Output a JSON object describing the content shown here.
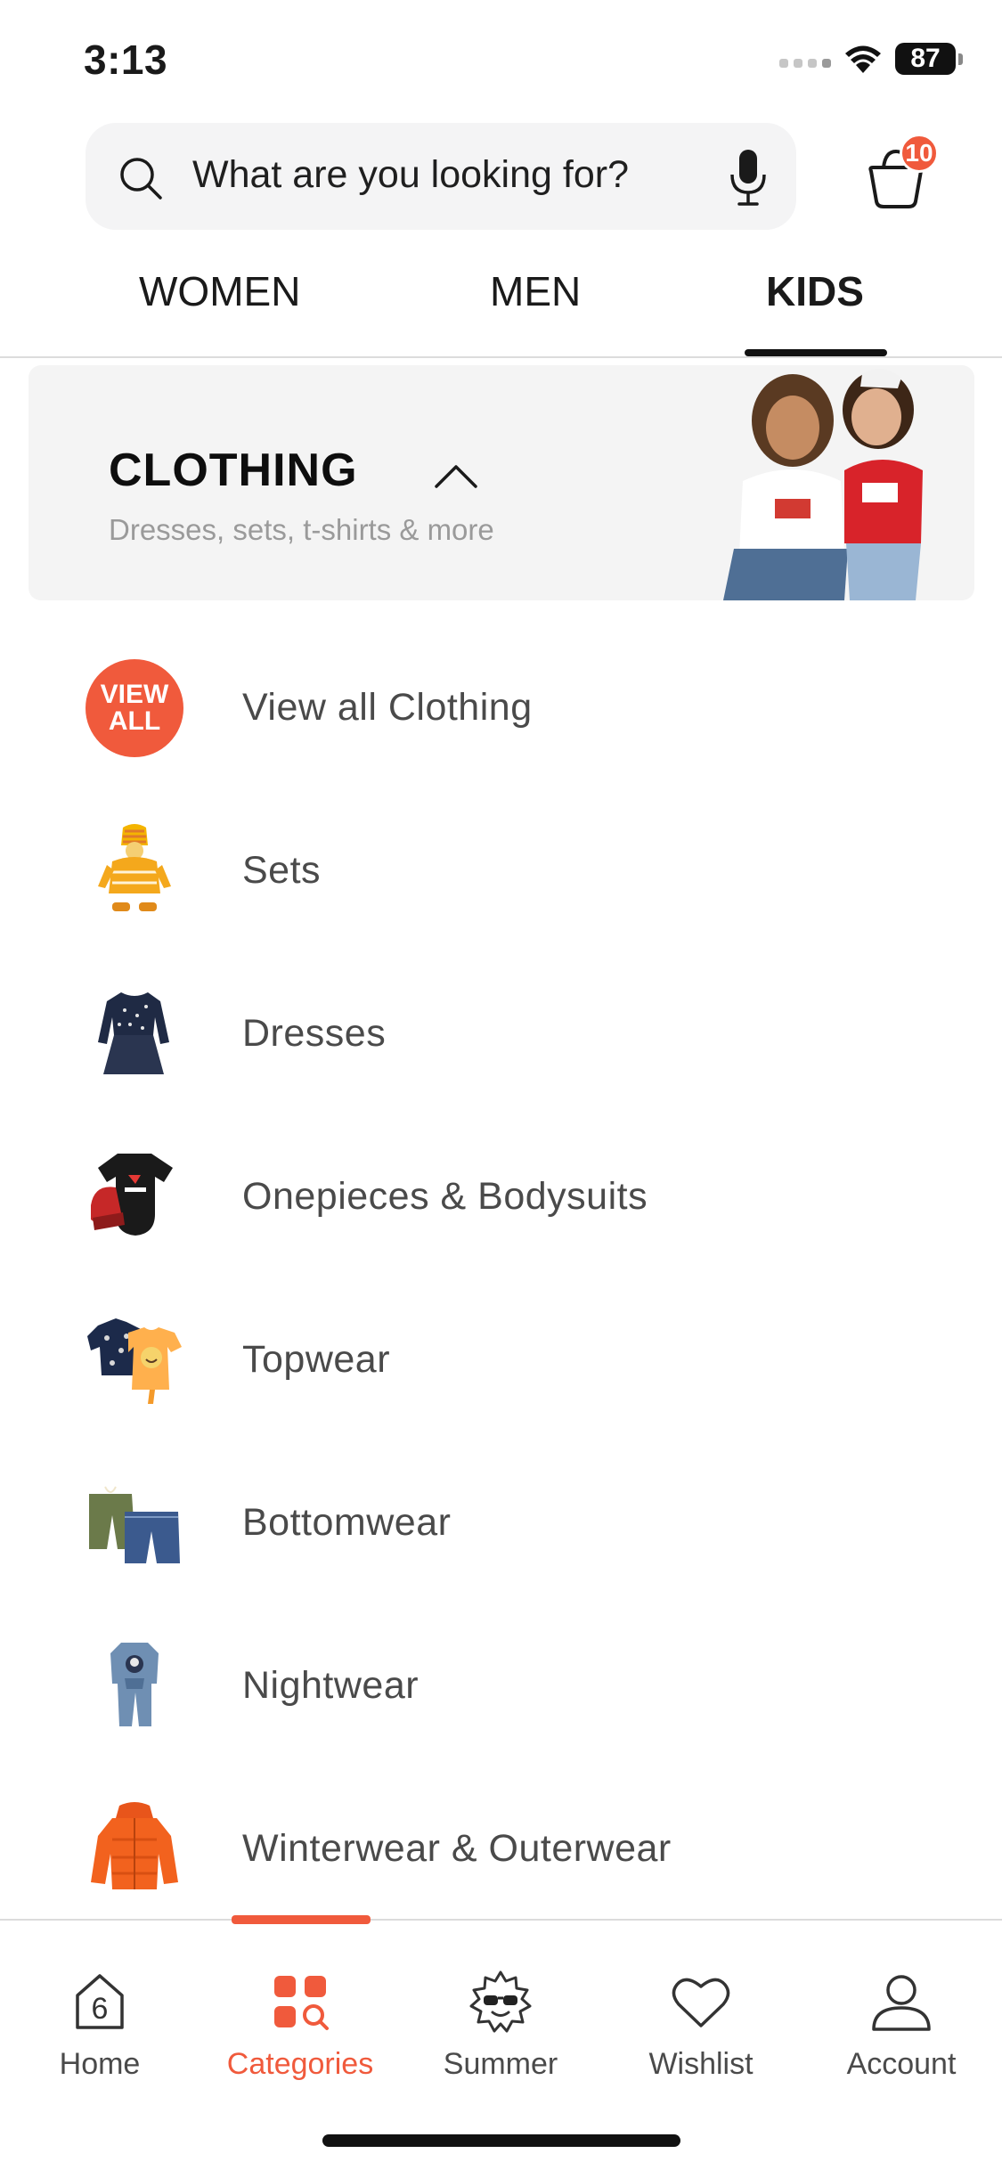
{
  "status_bar": {
    "time": "3:13",
    "battery": "87"
  },
  "search": {
    "placeholder": "What are you looking for?",
    "icon": "search-icon",
    "mic_icon": "microphone-icon"
  },
  "cart": {
    "icon": "shopping-bag-icon",
    "badge": "10"
  },
  "tabs": [
    {
      "label": "WOMEN",
      "active": false
    },
    {
      "label": "MEN",
      "active": false
    },
    {
      "label": "KIDS",
      "active": true
    }
  ],
  "section": {
    "title": "CLOTHING",
    "subtitle": "Dresses, sets, t-shirts & more",
    "expanded": true,
    "chevron_icon": "chevron-up-icon"
  },
  "view_all_badge": {
    "line1": "VIEW",
    "line2": "ALL"
  },
  "categories": [
    {
      "label": "View all Clothing",
      "thumb": "view-all-badge"
    },
    {
      "label": "Sets",
      "thumb": "sets-thumbnail"
    },
    {
      "label": "Dresses",
      "thumb": "dress-thumbnail"
    },
    {
      "label": "Onepieces & Bodysuits",
      "thumb": "bodysuit-thumbnail"
    },
    {
      "label": "Topwear",
      "thumb": "topwear-thumbnail"
    },
    {
      "label": "Bottomwear",
      "thumb": "bottomwear-thumbnail"
    },
    {
      "label": "Nightwear",
      "thumb": "nightwear-thumbnail"
    },
    {
      "label": "Winterwear & Outerwear",
      "thumb": "jacket-thumbnail"
    }
  ],
  "bottom_nav": [
    {
      "label": "Home",
      "icon": "home-icon",
      "active": false
    },
    {
      "label": "Categories",
      "icon": "categories-icon",
      "active": true
    },
    {
      "label": "Summer",
      "icon": "summer-sun-icon",
      "active": false
    },
    {
      "label": "Wishlist",
      "icon": "heart-icon",
      "active": false
    },
    {
      "label": "Account",
      "icon": "account-icon",
      "active": false
    }
  ],
  "colors": {
    "accent": "#f05a3c",
    "text": "#1a1a1a",
    "muted": "#9a9a9a",
    "card_bg": "#f4f4f4"
  }
}
